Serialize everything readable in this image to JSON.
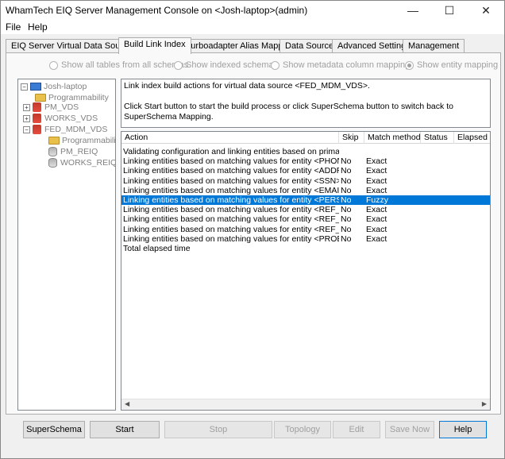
{
  "window": {
    "title": "WhamTech EIQ Server Management Console on <Josh-laptop>(admin)",
    "minimize_glyph": "—",
    "maximize_glyph": "☐",
    "close_glyph": "✕"
  },
  "menu": [
    "File",
    "Help"
  ],
  "tabs": [
    "EIQ Server Virtual Data Sources",
    "Build Link Index",
    "Turboadapter Alias Mapping",
    "Data Sources",
    "Advanced Settings",
    "Management"
  ],
  "radios": [
    {
      "label": "Show all tables from all schemas",
      "checked": false
    },
    {
      "label": "Show indexed schemas",
      "checked": false
    },
    {
      "label": "Show metadata column mapping",
      "checked": false
    },
    {
      "label": "Show entity mapping",
      "checked": true
    }
  ],
  "tree": [
    {
      "label": "Josh-laptop",
      "icon": "laptop-icon",
      "expander": "−"
    },
    {
      "label": "Programmability",
      "icon": "folder-icon",
      "expander": ""
    },
    {
      "label": "PM_VDS",
      "icon": "database-icon",
      "expander": "+"
    },
    {
      "label": "WORKS_VDS",
      "icon": "database-icon",
      "expander": "+"
    },
    {
      "label": "FED_MDM_VDS",
      "icon": "database-icon",
      "expander": "−"
    },
    {
      "label": "Programmability",
      "icon": "folder-icon",
      "expander": ""
    },
    {
      "label": "PM_REIQ",
      "icon": "database-icon",
      "expander": ""
    },
    {
      "label": "WORKS_REIQ",
      "icon": "database-icon",
      "expander": ""
    }
  ],
  "description": {
    "line1": "Link index build actions for virtual data source <FED_MDM_VDS>.",
    "line2": "Click Start button to start the build process or click SuperSchema button to switch back to SuperSchema Mapping."
  },
  "grid": {
    "columns": [
      "Action",
      "Skip",
      "Match method",
      "Status",
      "Elapsed time"
    ],
    "rows": [
      {
        "action": "Validating configuration and linking entities based on primary an...",
        "skip": "",
        "method": "",
        "selected": false
      },
      {
        "action": "Linking entities based on matching values for entity <PHONE>",
        "skip": "No",
        "method": "Exact",
        "selected": false
      },
      {
        "action": "Linking entities based on matching values for entity <ADDRESS>",
        "skip": "No",
        "method": "Exact",
        "selected": false
      },
      {
        "action": "Linking entities based on matching values for entity <SSN>",
        "skip": "No",
        "method": "Exact",
        "selected": false
      },
      {
        "action": "Linking entities based on matching values for entity <EMAIL>",
        "skip": "No",
        "method": "Exact",
        "selected": false
      },
      {
        "action": "Linking entities based on matching values for entity <PERSON>",
        "skip": "No",
        "method": "Fuzzy",
        "selected": true
      },
      {
        "action": "Linking entities based on matching values for entity <REF_DIAG...",
        "skip": "No",
        "method": "Exact",
        "selected": false
      },
      {
        "action": "Linking entities based on matching values for entity <REF_MED...",
        "skip": "No",
        "method": "Exact",
        "selected": false
      },
      {
        "action": "Linking entities based on matching values for entity <REF_LAB...",
        "skip": "No",
        "method": "Exact",
        "selected": false
      },
      {
        "action": "Linking entities based on matching values for entity <PROBLEM>",
        "skip": "No",
        "method": "Exact",
        "selected": false
      },
      {
        "action": "Total elapsed time",
        "skip": "",
        "method": "",
        "selected": false
      }
    ]
  },
  "buttons": [
    {
      "label": "SuperSchema",
      "enabled": true,
      "default": false
    },
    {
      "label": "Start",
      "enabled": true,
      "default": false
    },
    {
      "label": "Stop",
      "enabled": false,
      "default": false
    },
    {
      "label": "Topology",
      "enabled": false,
      "default": false
    },
    {
      "label": "Edit",
      "enabled": false,
      "default": false
    },
    {
      "label": "Save Now",
      "enabled": false,
      "default": false
    },
    {
      "label": "Help",
      "enabled": true,
      "default": true
    }
  ],
  "colors": {
    "selection": "#0078d7",
    "disabled_text": "#a0a0a0"
  }
}
